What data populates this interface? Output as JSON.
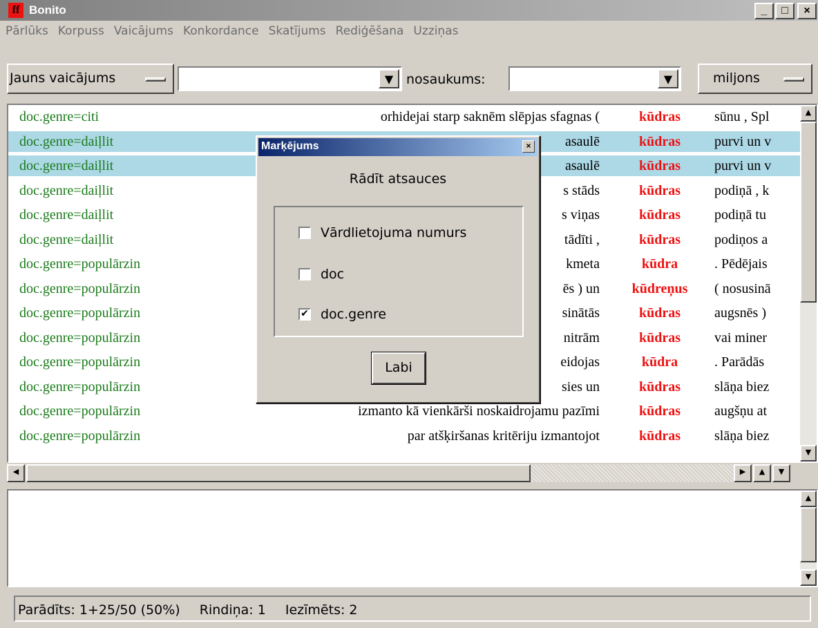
{
  "window": {
    "title": "Bonito",
    "icon_text": "ff"
  },
  "menu": [
    "Pārlūks",
    "Korpuss",
    "Vaicājums",
    "Konkordance",
    "Skatījums",
    "Rediģēšana",
    "Uzziņas"
  ],
  "toolbar": {
    "mode_label": "Jauns vaicājums",
    "query_value": "",
    "name_label": "nosaukums:",
    "name_value": "",
    "size_label": "miljons"
  },
  "concordance": {
    "rows": [
      {
        "ref": "doc.genre=citi",
        "left": "orhidejai starp saknēm slēpjas sfagnas (",
        "kwic": "kūdras",
        "right": "sūnu , Spl",
        "selected": false
      },
      {
        "ref": "doc.genre=daiļlit",
        "left": "asaulē",
        "kwic": "kūdras",
        "right": "purvi un v",
        "selected": true
      },
      {
        "ref": "doc.genre=daiļlit",
        "left": "asaulē",
        "kwic": "kūdras",
        "right": "purvi un v",
        "selected": true
      },
      {
        "ref": "doc.genre=daiļlit",
        "left": "s stāds",
        "kwic": "kūdras",
        "right": "podiņā , k",
        "selected": false
      },
      {
        "ref": "doc.genre=daiļlit",
        "left": "s viņas",
        "kwic": "kūdras",
        "right": "podiņā tu",
        "selected": false
      },
      {
        "ref": "doc.genre=daiļlit",
        "left": "tādīti ,",
        "kwic": "kūdras",
        "right": "podiņos a",
        "selected": false
      },
      {
        "ref": "doc.genre=populārzin",
        "left": "kmeta",
        "kwic": "kūdra",
        "right": ". Pēdējais",
        "selected": false
      },
      {
        "ref": "doc.genre=populārzin",
        "left": "ēs ) un",
        "kwic": "kūdreņus",
        "right": "( nosusinā",
        "selected": false
      },
      {
        "ref": "doc.genre=populārzin",
        "left": "sinātās",
        "kwic": "kūdras",
        "right": "augsnēs )",
        "selected": false
      },
      {
        "ref": "doc.genre=populārzin",
        "left": "nitrām",
        "kwic": "kūdras",
        "right": "vai miner",
        "selected": false
      },
      {
        "ref": "doc.genre=populārzin",
        "left": "eidojas",
        "kwic": "kūdra",
        "right": ". Parādās",
        "selected": false
      },
      {
        "ref": "doc.genre=populārzin",
        "left": "sies un",
        "kwic": "kūdras",
        "right": "slāņa biez",
        "selected": false
      },
      {
        "ref": "doc.genre=populārzin",
        "left": "izmanto kā vienkārši noskaidrojamu pazīmi",
        "kwic": "kūdras",
        "right": "augšņu at",
        "selected": false
      },
      {
        "ref": "doc.genre=populārzin",
        "left": "par atšķiršanas kritēriju izmantojot",
        "kwic": "kūdras",
        "right": "slāņa biez",
        "selected": false
      }
    ],
    "vscroll_position": 0.0,
    "hscroll_position": 0.0
  },
  "dialog": {
    "title": "Marķējums",
    "heading": "Rādīt atsauces",
    "options": [
      {
        "label": "Vārdlietojuma numurs",
        "checked": false
      },
      {
        "label": "doc",
        "checked": false
      },
      {
        "label": "doc.genre",
        "checked": true
      }
    ],
    "ok_label": "Labi"
  },
  "status": {
    "shown": "Parādīts: 1+25/50  (50%)",
    "line": "Rindiņa: 1",
    "marked": "Iezīmēts: 2"
  },
  "colors": {
    "reference": "#1a7a1a",
    "keyword": "#ee1111",
    "selection": "#add8e6",
    "dialog_title": "#0a246a"
  }
}
